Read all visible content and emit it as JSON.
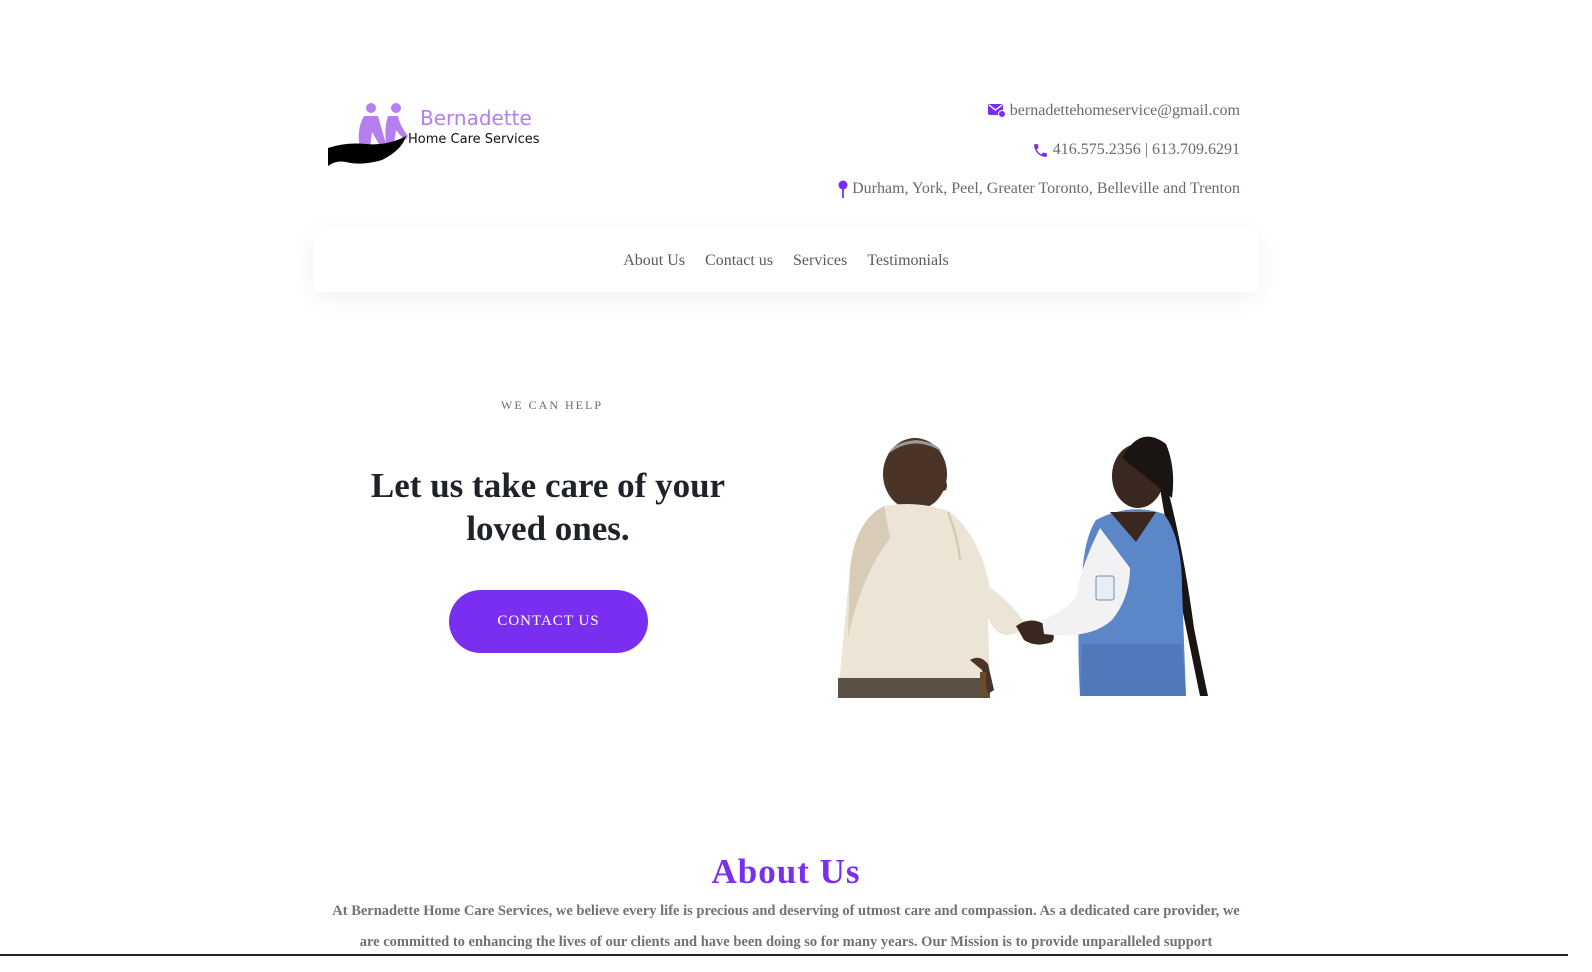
{
  "header": {
    "logo": {
      "name": "Bernadette",
      "sub": "Home Care Services"
    },
    "contact": {
      "email": "bernadettehomeservice@gmail.com",
      "phone": "416.575.2356 | 613.709.6291",
      "location": "Durham, York, Peel, Greater Toronto, Belleville and Trenton"
    }
  },
  "nav": {
    "items": [
      {
        "label": "About Us"
      },
      {
        "label": "Contact us"
      },
      {
        "label": "Services"
      },
      {
        "label": "Testimonials"
      }
    ]
  },
  "hero": {
    "eyebrow": "WE CAN HELP",
    "title": "Let us take care of your loved ones.",
    "cta_label": "CONTACT US"
  },
  "about": {
    "title": "About Us",
    "text": "At Bernadette Home Care Services, we believe every life is precious and deserving of utmost care and compassion. As a dedicated care provider, we are committed to enhancing the lives of our clients and have been doing so for many years. Our Mission is to provide unparalleled support"
  },
  "colors": {
    "accent": "#7a2ff0",
    "logo_purple": "#b57ff0",
    "text_muted": "#666a73",
    "heading": "#1f2329"
  },
  "icons": {
    "email": "mail-icon",
    "phone": "phone-icon",
    "location": "map-pin-icon"
  }
}
